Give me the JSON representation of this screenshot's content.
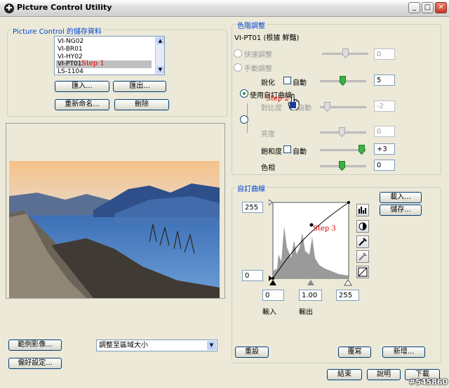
{
  "window": {
    "title": "Picture Control Utility",
    "minimize": "_",
    "maximize": "□",
    "close": "✕"
  },
  "storage": {
    "group_label": "Picture Control 的儲存資料",
    "items": [
      "VI-NG02",
      "VI-BR01",
      "VI-HY02",
      "VI-PT01",
      "LS-1104"
    ],
    "selected_index": 3,
    "step_label": "Step 1",
    "import_btn": "匯入...",
    "export_btn": "匯出...",
    "rename_btn": "重新命名...",
    "delete_btn": "刪除"
  },
  "preview": {
    "sample_btn": "範例影像...",
    "fit_select": "調整至區域大小",
    "prefs_btn": "偏好設定..."
  },
  "adjust": {
    "group_label": "色階調整",
    "profile_name": "VI-PT01 (根據 鮮豔)",
    "quick_label": "快速調整",
    "quick_value": "0",
    "manual_label": "手動調整",
    "sharpening_label": "銳化",
    "sharpening_auto": "自動",
    "sharpening_value": "5",
    "use_curve_label": "使用自訂曲線",
    "step2_label": "Step 2",
    "contrast_label": "對比度",
    "contrast_auto": "自動",
    "contrast_value": "-2",
    "brightness_label": "亮度",
    "brightness_value": "0",
    "saturation_label": "飽和度",
    "saturation_auto": "自動",
    "saturation_value": "+3",
    "hue_label": "色相",
    "hue_value": "0"
  },
  "curve": {
    "group_label": "自訂曲線",
    "load_btn": "載入...",
    "save_btn": "儲存...",
    "out_max": "255",
    "out_min": "0",
    "in_black": "0",
    "gamma": "1.00",
    "in_white": "255",
    "input_label": "輸入",
    "output_label": "輸出",
    "step3_label": "Step 3",
    "reset_btn": "重設",
    "copy_btn": "覆寫",
    "add_btn": "新增..."
  },
  "footer": {
    "exit_btn": "結束",
    "help_btn": "說明",
    "download_btn": "下載",
    "watermark": "#545860"
  },
  "colors": {
    "accent": "#0046d5",
    "step": "#e00000",
    "window_bg": "#ece9d8"
  }
}
